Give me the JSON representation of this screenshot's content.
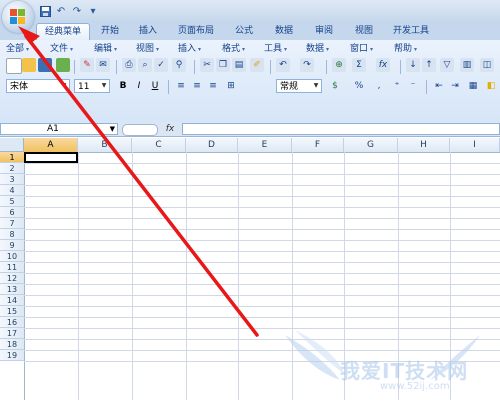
{
  "qat": {
    "undo_icon": "↶",
    "redo_icon": "↷",
    "customize_icon": "▾"
  },
  "tabs": [
    {
      "label": "经典菜单",
      "active": true
    },
    {
      "label": "开始"
    },
    {
      "label": "插入"
    },
    {
      "label": "页面布局"
    },
    {
      "label": "公式"
    },
    {
      "label": "数据"
    },
    {
      "label": "审阅"
    },
    {
      "label": "视图"
    },
    {
      "label": "开发工具"
    }
  ],
  "menu": [
    "全部",
    "文件",
    "编辑",
    "视图",
    "插入",
    "格式",
    "工具",
    "数据",
    "窗口",
    "帮助"
  ],
  "font": {
    "name": "宋体",
    "size": "11"
  },
  "number_format": "常规",
  "format_buttons": {
    "bold": "B",
    "italic": "I",
    "underline": "U",
    "percent": "%",
    "comma": ",",
    "sigma": "Σ",
    "fx": "fx"
  },
  "name_box": "A1",
  "fx_label": "fx",
  "columns": [
    "A",
    "B",
    "C",
    "D",
    "E",
    "F",
    "G",
    "H",
    "I"
  ],
  "rows": [
    "1",
    "2",
    "3",
    "4",
    "5",
    "6",
    "7",
    "8",
    "9",
    "10",
    "11",
    "12",
    "13",
    "14",
    "15",
    "16",
    "17",
    "18",
    "19"
  ],
  "selected_cell": "A1",
  "watermark": {
    "text": "我爱IT技术网",
    "url": "www.52ij.com"
  },
  "colors": {
    "accent": "#15428b",
    "arrow": "#e81818",
    "selection": "#f1c15f"
  }
}
